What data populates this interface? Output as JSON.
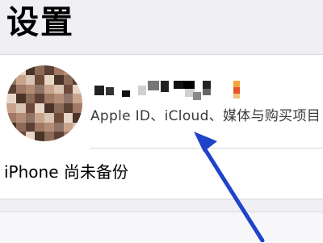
{
  "header": {
    "title": "设置"
  },
  "account": {
    "subtitle": "Apple ID、iCloud、媒体与购买项目"
  },
  "backup": {
    "label": "iPhone 尚未备份"
  },
  "colors": {
    "background": "#efeff4",
    "annotation_arrow": "#1f43c9"
  }
}
